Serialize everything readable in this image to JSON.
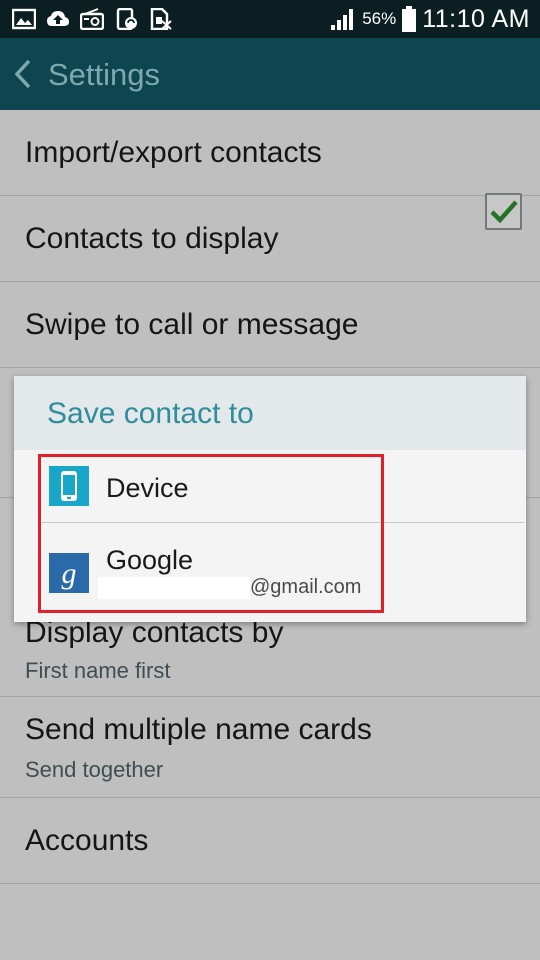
{
  "status_bar": {
    "battery_percent": "56%",
    "time": "11:10 AM",
    "icons": [
      "image-icon",
      "cloud-upload-icon",
      "radio-icon",
      "device-sync-icon",
      "sim-icon",
      "signal-icon",
      "battery-icon"
    ]
  },
  "action_bar": {
    "back_icon": "chevron-left-icon",
    "title": "Settings"
  },
  "settings": {
    "items": [
      {
        "title": "Import/export contacts"
      },
      {
        "title": "Contacts to display"
      },
      {
        "title": "Swipe to call or message",
        "checked": true
      },
      {
        "title": "Display contacts by",
        "subtitle": "First name first"
      },
      {
        "title": "Send multiple name cards",
        "subtitle": "Send together"
      },
      {
        "title": "Accounts"
      }
    ]
  },
  "dialog": {
    "title": "Save contact to",
    "options": [
      {
        "label": "Device",
        "icon": "phone-icon"
      },
      {
        "label": "Google",
        "icon": "google-icon",
        "email_suffix": "@gmail.com"
      }
    ]
  },
  "colors": {
    "status_bar_bg": "#0b1f22",
    "action_bar_bg": "#0d4550",
    "dialog_title": "#2f8d9e",
    "checkbox_check": "#2e8b2e",
    "highlight_border": "#e0202a"
  }
}
